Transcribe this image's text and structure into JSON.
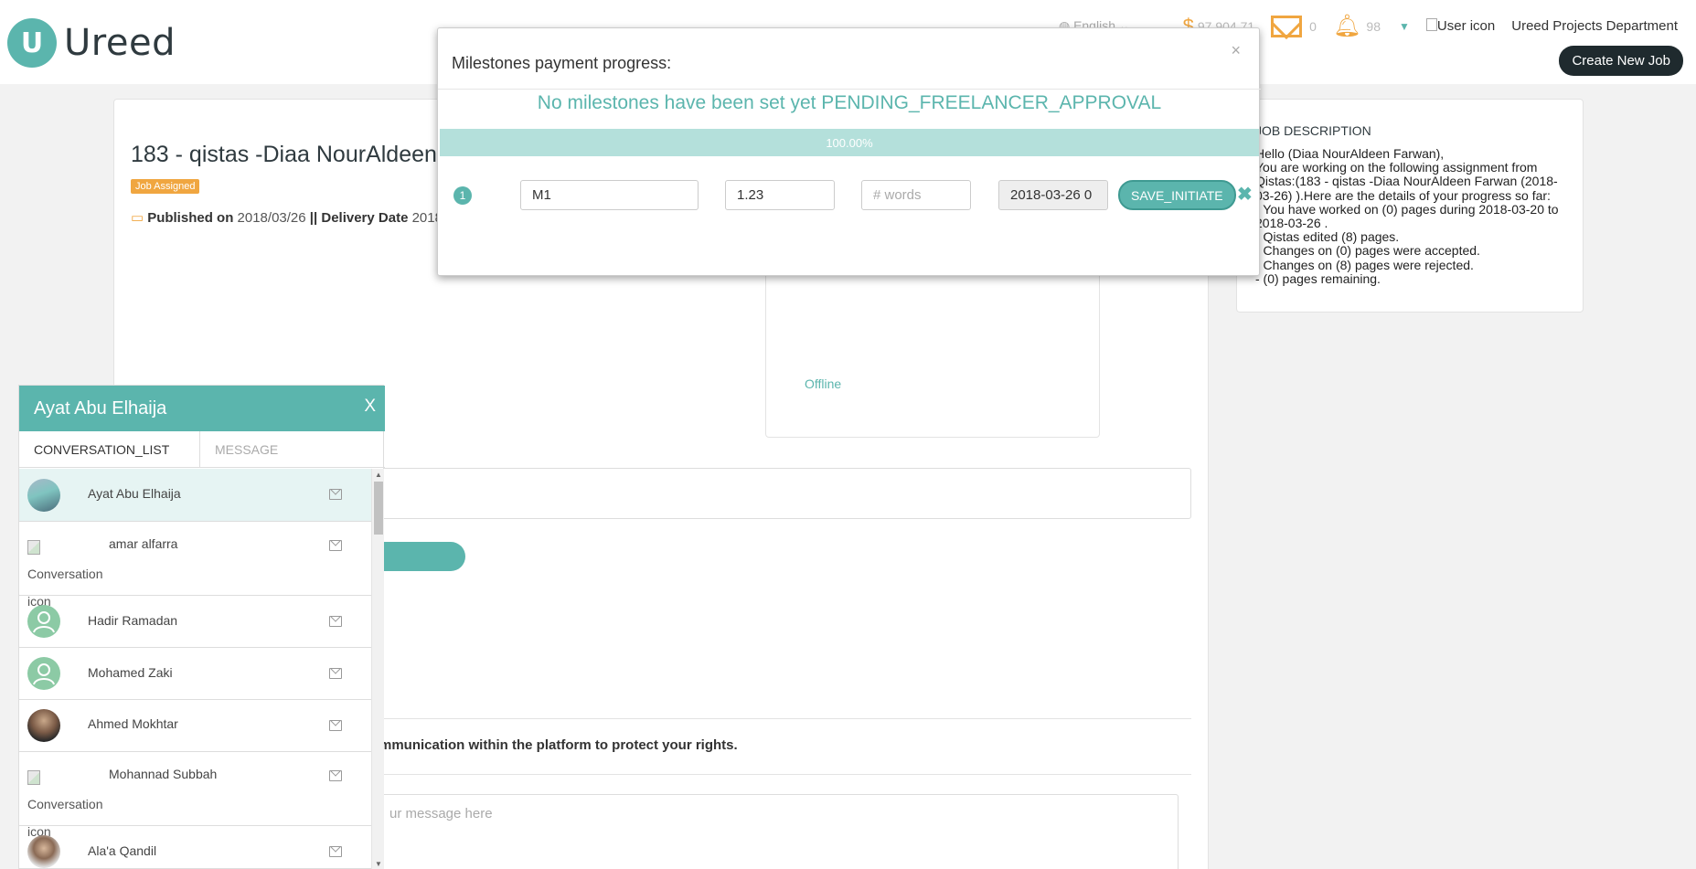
{
  "brand": {
    "logo_letter": "U",
    "name": "Ureed"
  },
  "topbar": {
    "language": "English",
    "balance": "97,904.71",
    "messages_count": "0",
    "notifications_count": "98",
    "user_icon_alt": "User icon",
    "department": "Ureed Projects Department",
    "create_job": "Create New Job"
  },
  "job": {
    "title": "183 - qistas -Diaa NourAldeen",
    "badge": "Job Assigned",
    "published_label": "Published on",
    "published_date": "2018/03/26",
    "separator": "||",
    "delivery_label": "Delivery Date",
    "delivery_date": "2018",
    "status_offline": "Offline",
    "warning": "mmunication within the platform to protect your rights.",
    "message_placeholder": "ur message here"
  },
  "description": {
    "title": "JOB DESCRIPTION",
    "lines": [
      "Hello (Diaa NourAldeen Farwan),",
      "You are working on the following assignment from Qistas:(183 - qistas -Diaa NourAldeen Farwan (2018-03-26) ).Here are the details of your progress so far:",
      "- You have worked on (0) pages during 2018-03-20 to 2018-03-26 .",
      "- Qistas edited (8) pages.",
      "- Changes on (0) pages were accepted.",
      "- Changes on (8) pages were rejected.",
      "- (0) pages remaining."
    ]
  },
  "modal": {
    "title": "Milestones payment progress:",
    "close": "×",
    "status": "No milestones have been set yet PENDING_FREELANCER_APPROVAL",
    "progress_label": "100.00%",
    "progress_value": 1.0,
    "milestone": {
      "number": "1",
      "name": "M1",
      "amount": "1.23",
      "words_placeholder": "# words",
      "date": "2018-03-26 0",
      "save_label": "SAVE_INITIATE",
      "delete": "✖"
    }
  },
  "chat": {
    "title": "Ayat Abu Elhaija",
    "close": "X",
    "tabs": [
      "CONVERSATION_LIST",
      "MESSAGE"
    ],
    "broken_alt": "Conversation icon",
    "items": [
      {
        "name": "Ayat Abu Elhaija",
        "avatar": "photo"
      },
      {
        "name": "amar alfarra",
        "avatar": "broken"
      },
      {
        "name": "Hadir Ramadan",
        "avatar": "default"
      },
      {
        "name": "Mohamed Zaki",
        "avatar": "default"
      },
      {
        "name": "Ahmed Mokhtar",
        "avatar": "photo"
      },
      {
        "name": "Mohannad Subbah",
        "avatar": "broken"
      },
      {
        "name": "Ala'a Qandil",
        "avatar": "photo"
      }
    ]
  },
  "colors": {
    "accent": "#5bb5ad",
    "orange": "#f0a640",
    "dark": "#1f2a2e"
  }
}
